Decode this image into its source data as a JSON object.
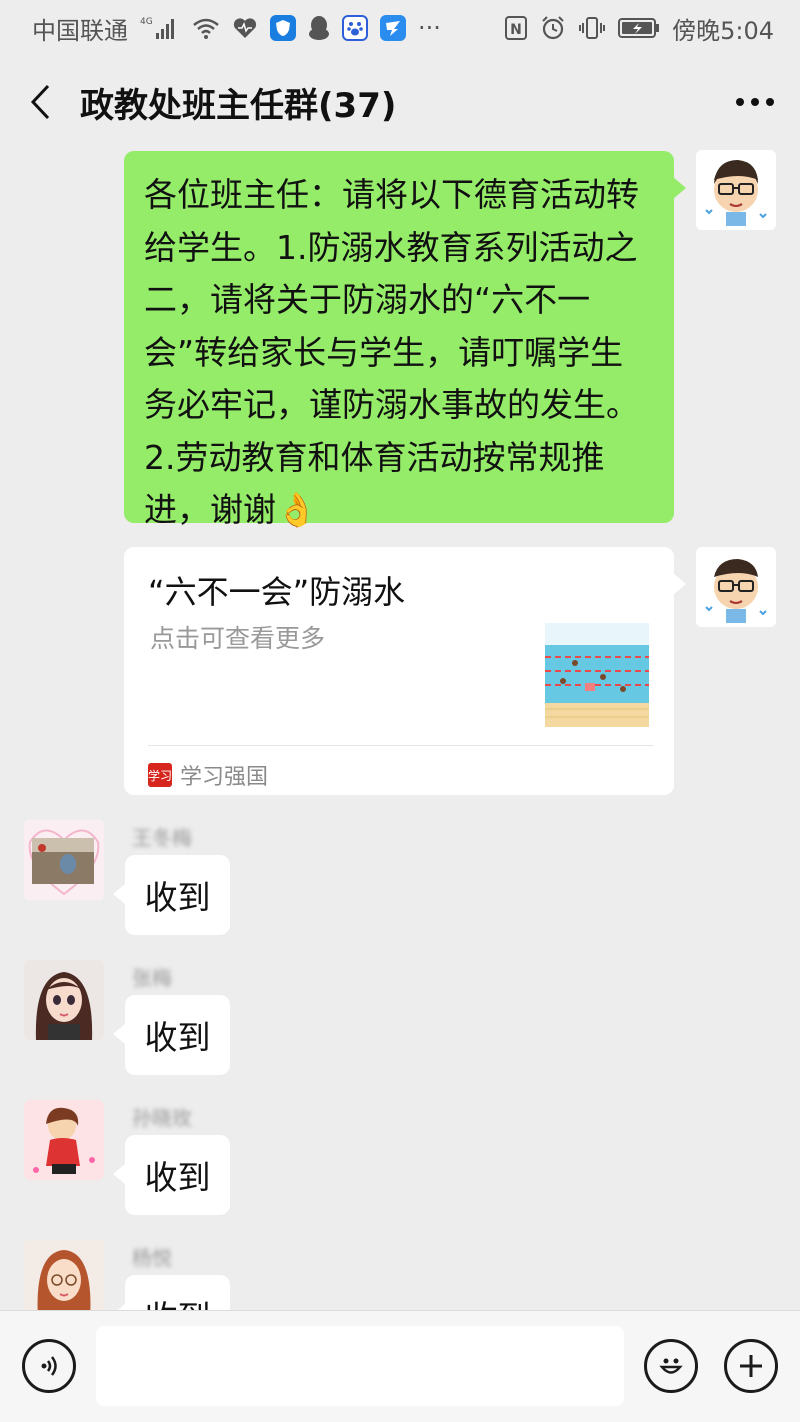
{
  "status_bar": {
    "carrier": "中国联通",
    "network": "4G",
    "time": "傍晚5:04",
    "more": "···",
    "nfc": "N"
  },
  "nav": {
    "title": "政教处班主任群(37)"
  },
  "messages": [
    {
      "type": "text",
      "side": "right",
      "text": "各位班主任：请将以下德育活动转给学生。1.防溺水教育系列活动之二，请将关于防溺水的“六不一会”转给家长与学生，请叮嘱学生务必牢记，谨防溺水事故的发生。2.劳动教育和体育活动按常规推进，谢谢👌"
    },
    {
      "type": "link",
      "side": "right",
      "title": "“六不一会”防溺水",
      "description": "点击可查看更多",
      "source": "学习强国",
      "source_logo_text": "学习"
    },
    {
      "type": "text",
      "side": "left",
      "sender": "王冬梅",
      "text": "收到"
    },
    {
      "type": "text",
      "side": "left",
      "sender": "张梅",
      "text": "收到"
    },
    {
      "type": "text",
      "side": "left",
      "sender": "孙晓玫",
      "text": "收到"
    },
    {
      "type": "text",
      "side": "left",
      "sender": "杨悦",
      "text": "收到"
    }
  ],
  "colors": {
    "my_bubble": "#95ec69",
    "other_bubble": "#ffffff",
    "background": "#ededed"
  },
  "input": {
    "placeholder": ""
  }
}
